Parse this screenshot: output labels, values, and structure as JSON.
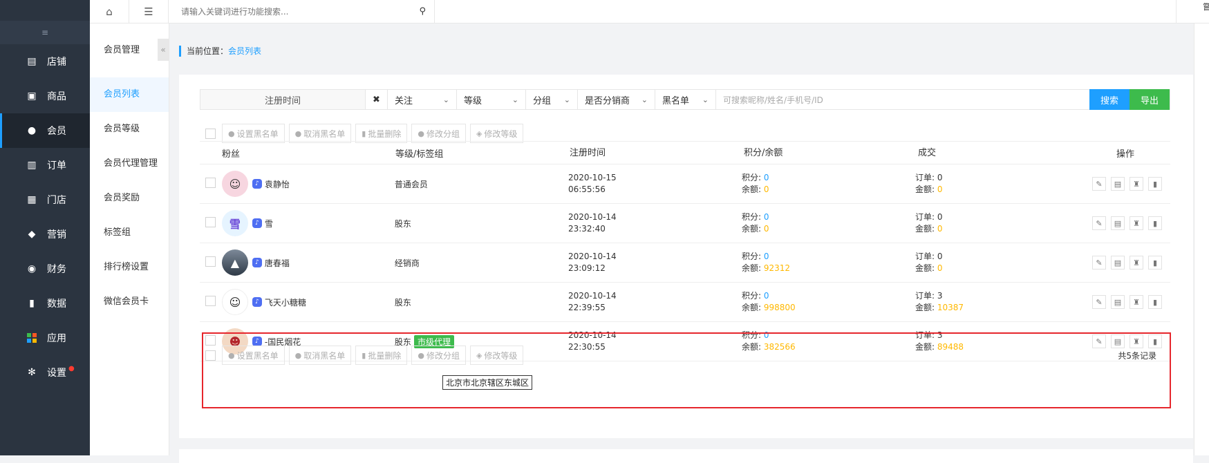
{
  "sidebar": {
    "collapse_icon": "≡",
    "items": [
      {
        "label": "店铺",
        "icon": "store-icon"
      },
      {
        "label": "商品",
        "icon": "goods-icon"
      },
      {
        "label": "会员",
        "icon": "user-icon"
      },
      {
        "label": "订单",
        "icon": "order-icon"
      },
      {
        "label": "门店",
        "icon": "shop-icon"
      },
      {
        "label": "营销",
        "icon": "gift-icon"
      },
      {
        "label": "财务",
        "icon": "money-icon"
      },
      {
        "label": "数据",
        "icon": "chart-icon"
      },
      {
        "label": "应用",
        "icon": "apps-icon"
      },
      {
        "label": "设置",
        "icon": "gear-icon"
      }
    ]
  },
  "subnav": {
    "title": "会员管理",
    "items": [
      "会员列表",
      "会员等级",
      "会员代理管理",
      "会员奖励",
      "标签组",
      "排行榜设置",
      "微信会员卡"
    ]
  },
  "topbar": {
    "search_placeholder": "请输入关键词进行功能搜索...",
    "right_text": "嘗"
  },
  "breadcrumb": {
    "prefix": "当前位置：",
    "current": "会员列表"
  },
  "filter": {
    "date_placeholder": "注册时间",
    "clear": "✖",
    "follow": "关注",
    "level": "等级",
    "group": "分组",
    "distributor": "是否分销商",
    "blacklist": "黑名单",
    "keyword_placeholder": "可搜索昵称/姓名/手机号/ID",
    "search_btn": "搜索",
    "export_btn": "导出"
  },
  "bulk_actions": {
    "set_blacklist": "设置黑名单",
    "cancel_blacklist": "取消黑名单",
    "batch_delete": "批量删除",
    "edit_group": "修改分组",
    "edit_level": "修改等级"
  },
  "table": {
    "headers": {
      "fans": "粉丝",
      "level": "等级/标签组",
      "reg_time": "注册时间",
      "points": "积分/余额",
      "deal": "成交",
      "ops": "操作"
    },
    "points_label": "积分: ",
    "balance_label": "余额: ",
    "orders_label": "订单: ",
    "amount_label": "金额: ",
    "rows": [
      {
        "name": "袁静怡",
        "level": "普通会员",
        "tag": "",
        "date": "2020-10-15",
        "time": "06:55:56",
        "points": "0",
        "balance": "0",
        "orders": "0",
        "amount": "0"
      },
      {
        "name": "雪",
        "level": "股东",
        "tag": "",
        "date": "2020-10-14",
        "time": "23:32:40",
        "points": "0",
        "balance": "0",
        "orders": "0",
        "amount": "0"
      },
      {
        "name": "唐春福",
        "level": "经销商",
        "tag": "",
        "date": "2020-10-14",
        "time": "23:09:12",
        "points": "0",
        "balance": "92312",
        "orders": "0",
        "amount": "0"
      },
      {
        "name": "飞天小糖糖",
        "level": "股东",
        "tag": "",
        "date": "2020-10-14",
        "time": "22:39:55",
        "points": "0",
        "balance": "998800",
        "orders": "3",
        "amount": "10387"
      },
      {
        "name": "-国民烟花",
        "level": "股东",
        "tag": "市级代理",
        "date": "2020-10-14",
        "time": "22:30:55",
        "points": "0",
        "balance": "382566",
        "orders": "3",
        "amount": "89488"
      }
    ]
  },
  "tooltip": "北京市北京辖区东城区",
  "total": "共5条记录",
  "colors": {
    "accent": "#1e9fff",
    "export": "#3dbb4c",
    "highlight": "#e6262c",
    "money": "#ffb800"
  }
}
